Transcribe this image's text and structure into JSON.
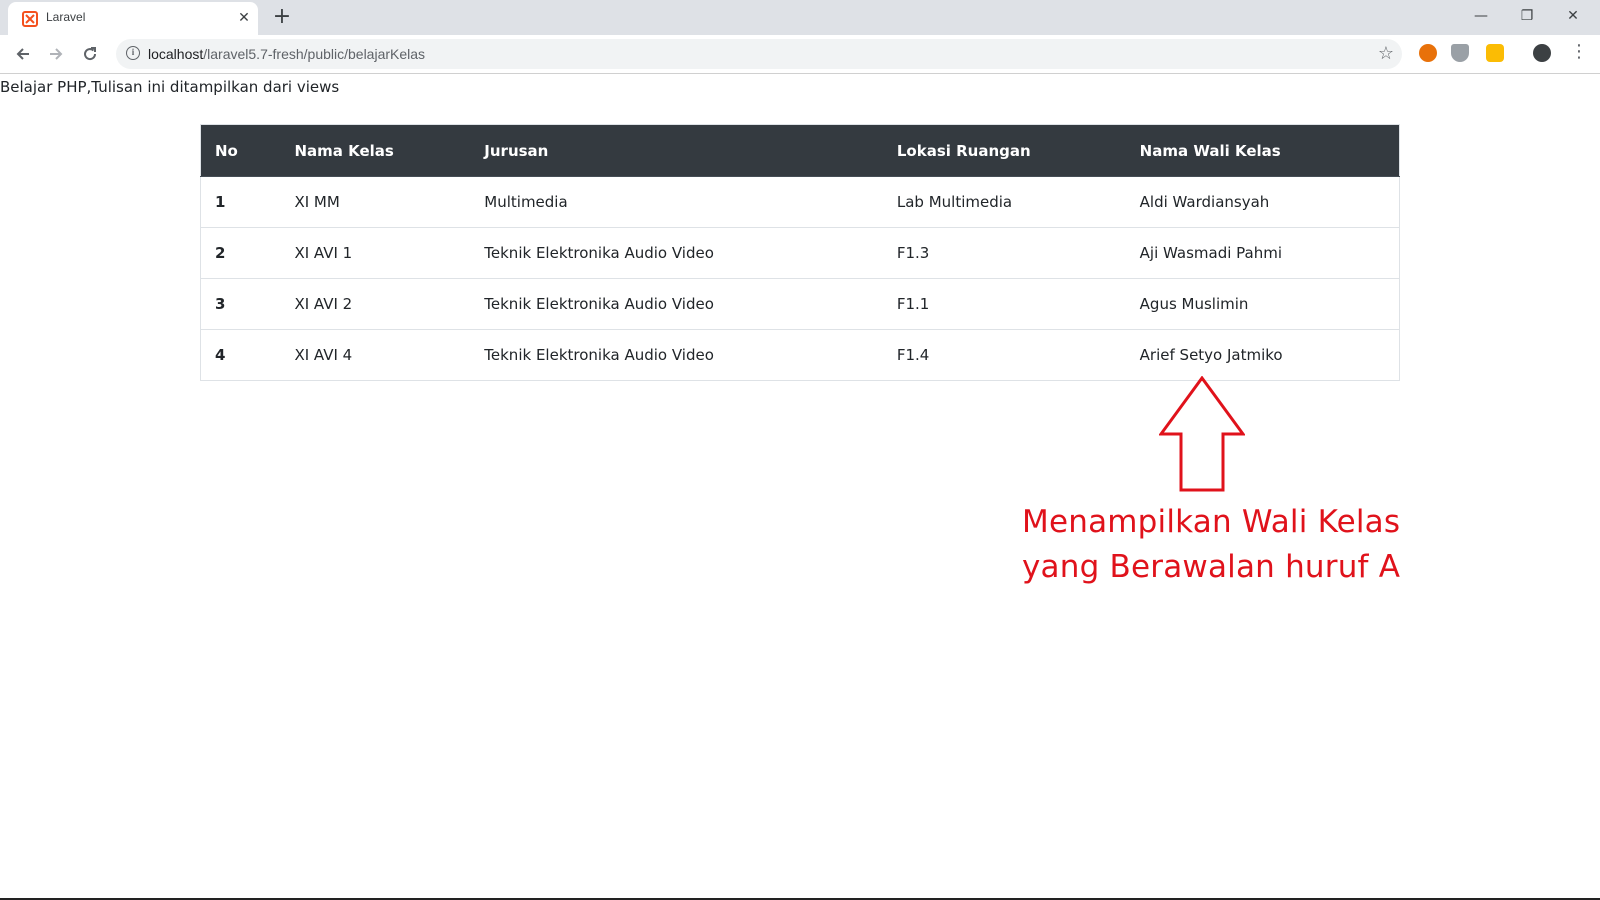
{
  "browser": {
    "tab_title": "Laravel",
    "tab_close": "✕",
    "new_tab": "+",
    "url_host": "localhost",
    "url_path": "/laravel5.7-fresh/public/belajarKelas",
    "window_controls": {
      "minimize": "—",
      "restore": "❐",
      "close": "✕"
    }
  },
  "page": {
    "intro_text": "Belajar PHP,Tulisan ini ditampilkan dari views",
    "table": {
      "headers": [
        "No",
        "Nama Kelas",
        "Jurusan",
        "Lokasi Ruangan",
        "Nama Wali Kelas"
      ],
      "rows": [
        [
          "1",
          "XI MM",
          "Multimedia",
          "Lab Multimedia",
          "Aldi Wardiansyah"
        ],
        [
          "2",
          "XI AVI 1",
          "Teknik Elektronika Audio Video",
          "F1.3",
          "Aji Wasmadi Pahmi"
        ],
        [
          "3",
          "XI AVI 2",
          "Teknik Elektronika Audio Video",
          "F1.1",
          "Agus Muslimin"
        ],
        [
          "4",
          "XI AVI 4",
          "Teknik Elektronika Audio Video",
          "F1.4",
          "Arief Setyo Jatmiko"
        ]
      ]
    },
    "annotation": {
      "line1": "Menampilkan Wali Kelas",
      "line2": "yang Berawalan huruf A",
      "color": "#e0121b"
    }
  },
  "colors": {
    "table_header_bg": "#343a40",
    "tabstrip_bg": "#dee1e6"
  },
  "icons": {
    "favicon": "laravel-icon",
    "info": "info-icon",
    "bookmark": "star-icon"
  }
}
